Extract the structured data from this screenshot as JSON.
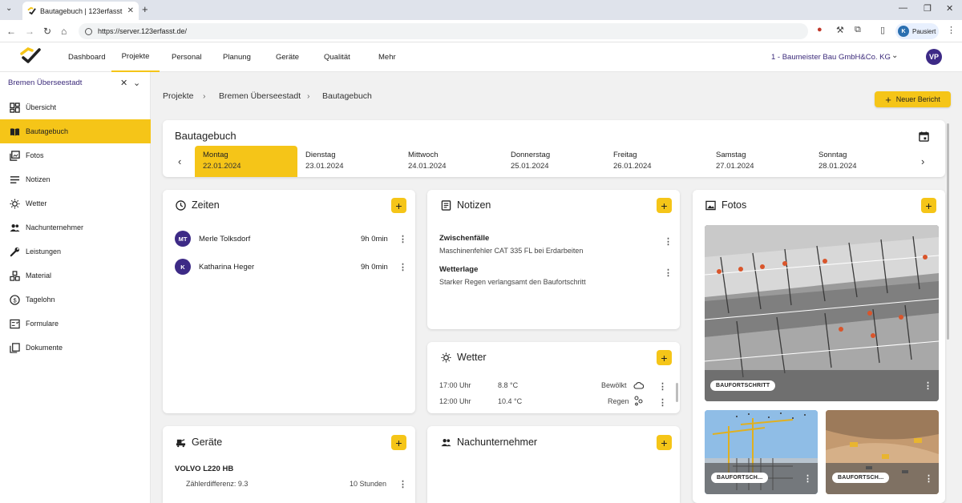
{
  "browser": {
    "tab_title": "Bautagebuch | 123erfasst",
    "url": "https://server.123erfasst.de/",
    "profile_initial": "K",
    "profile_label": "Pausiert"
  },
  "header": {
    "nav": [
      "Dashboard",
      "Projekte",
      "Personal",
      "Planung",
      "Geräte",
      "Qualität",
      "Mehr"
    ],
    "active_nav": "Projekte",
    "company": "1 - Baumeister Bau GmbH&Co. KG",
    "user_initials": "VP"
  },
  "sidebar": {
    "project": "Bremen Überseestadt",
    "items": [
      {
        "label": "Übersicht",
        "icon": "dashboard-icon"
      },
      {
        "label": "Bautagebuch",
        "icon": "book-icon"
      },
      {
        "label": "Fotos",
        "icon": "photos-icon"
      },
      {
        "label": "Notizen",
        "icon": "notes-icon"
      },
      {
        "label": "Wetter",
        "icon": "sun-icon"
      },
      {
        "label": "Nachunternehmer",
        "icon": "people-icon"
      },
      {
        "label": "Leistungen",
        "icon": "wrench-icon"
      },
      {
        "label": "Material",
        "icon": "material-icon"
      },
      {
        "label": "Tagelohn",
        "icon": "dollar-icon"
      },
      {
        "label": "Formulare",
        "icon": "form-icon"
      },
      {
        "label": "Dokumente",
        "icon": "documents-icon"
      }
    ],
    "active": "Bautagebuch"
  },
  "breadcrumb": [
    "Projekte",
    "Bremen Überseestadt",
    "Bautagebuch"
  ],
  "new_report_label": "Neuer Bericht",
  "week": {
    "title": "Bautagebuch",
    "days": [
      {
        "name": "Montag",
        "date": "22.01.2024"
      },
      {
        "name": "Dienstag",
        "date": "23.01.2024"
      },
      {
        "name": "Mittwoch",
        "date": "24.01.2024"
      },
      {
        "name": "Donnerstag",
        "date": "25.01.2024"
      },
      {
        "name": "Freitag",
        "date": "26.01.2024"
      },
      {
        "name": "Samstag",
        "date": "27.01.2024"
      },
      {
        "name": "Sonntag",
        "date": "28.01.2024"
      }
    ],
    "active_day": "Montag"
  },
  "zeiten": {
    "title": "Zeiten",
    "entries": [
      {
        "initials": "MT",
        "name": "Merle Tolksdorf",
        "time": "9h 0min"
      },
      {
        "initials": "K",
        "name": "Katharina Heger",
        "time": "9h 0min"
      }
    ]
  },
  "notizen": {
    "title": "Notizen",
    "entries": [
      {
        "heading": "Zwischenfälle",
        "text": "Maschinenfehler CAT 335 FL bei Erdarbeiten"
      },
      {
        "heading": "Wetterlage",
        "text": "Starker Regen verlangsamt den Baufortschritt"
      }
    ]
  },
  "wetter": {
    "title": "Wetter",
    "entries": [
      {
        "time": "17:00 Uhr",
        "temp": "8.8 °C",
        "condition": "Bewölkt",
        "icon": "cloud-icon"
      },
      {
        "time": "12:00 Uhr",
        "temp": "10.4 °C",
        "condition": "Regen",
        "icon": "rain-icon"
      }
    ]
  },
  "fotos": {
    "title": "Fotos",
    "tags": [
      "BAUFORTSCHRITT",
      "BAUFORTSCH...",
      "BAUFORTSCH..."
    ]
  },
  "geraete": {
    "title": "Geräte",
    "machine": "VOLVO L220 HB",
    "counter_label": "Zählerdifferenz: 9.3",
    "counter_value": "10 Stunden"
  },
  "nachunternehmer": {
    "title": "Nachunternehmer"
  },
  "colors": {
    "accent": "#f5c518",
    "brand": "#3d2a86"
  }
}
